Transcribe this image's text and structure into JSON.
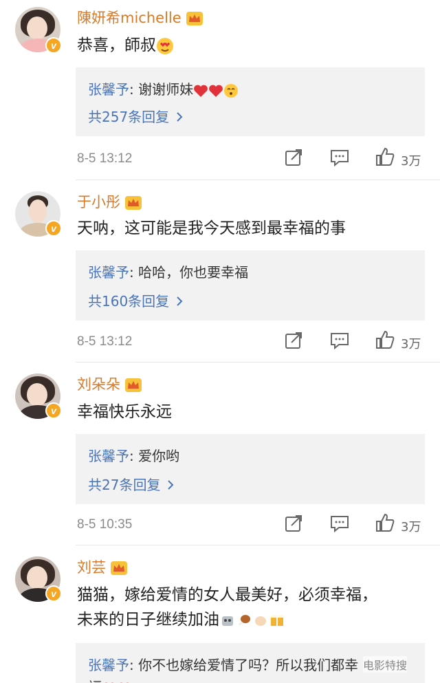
{
  "comments": [
    {
      "username": "陳妍希michelle",
      "text": "恭喜，師叔",
      "reply_author": "张馨予",
      "reply_text": "谢谢师妹",
      "more_replies": "共257条回复",
      "time": "8-5 13:12",
      "likes": "3万"
    },
    {
      "username": "于小彤",
      "text": "天呐，这可能是我今天感到最幸福的事",
      "reply_author": "张馨予",
      "reply_text": "哈哈，你也要幸福",
      "more_replies": "共160条回复",
      "time": "8-5 13:12",
      "likes": "3万"
    },
    {
      "username": "刘朵朵",
      "text": "幸福快乐永远",
      "reply_author": "张馨予",
      "reply_text": "爱你哟",
      "more_replies": "共27条回复",
      "time": "8-5 10:35",
      "likes": "3万"
    },
    {
      "username": "刘芸",
      "text_line1": "猫猫，嫁给爱情的女人最美好，必须幸福，",
      "text_line2": "未来的日子继续加油",
      "reply_author": "张馨予",
      "reply_text": "你不也嫁给爱情了吗？所以我们都幸",
      "reply_text_line2": "福"
    }
  ],
  "colors": {
    "username": "#d87a2a",
    "reply_author": "#4a74b8",
    "reply_bg": "#f2f2f2",
    "verified_badge": "#f5a623",
    "heart": "#e0323a"
  },
  "icons": [
    "crown-icon",
    "verified-badge-icon",
    "repost-icon",
    "comment-icon",
    "like-icon",
    "chevron-right-icon",
    "heart-icon",
    "wink-emoji-icon",
    "heart-eyes-emoji-icon"
  ],
  "watermark": "电影特搜"
}
